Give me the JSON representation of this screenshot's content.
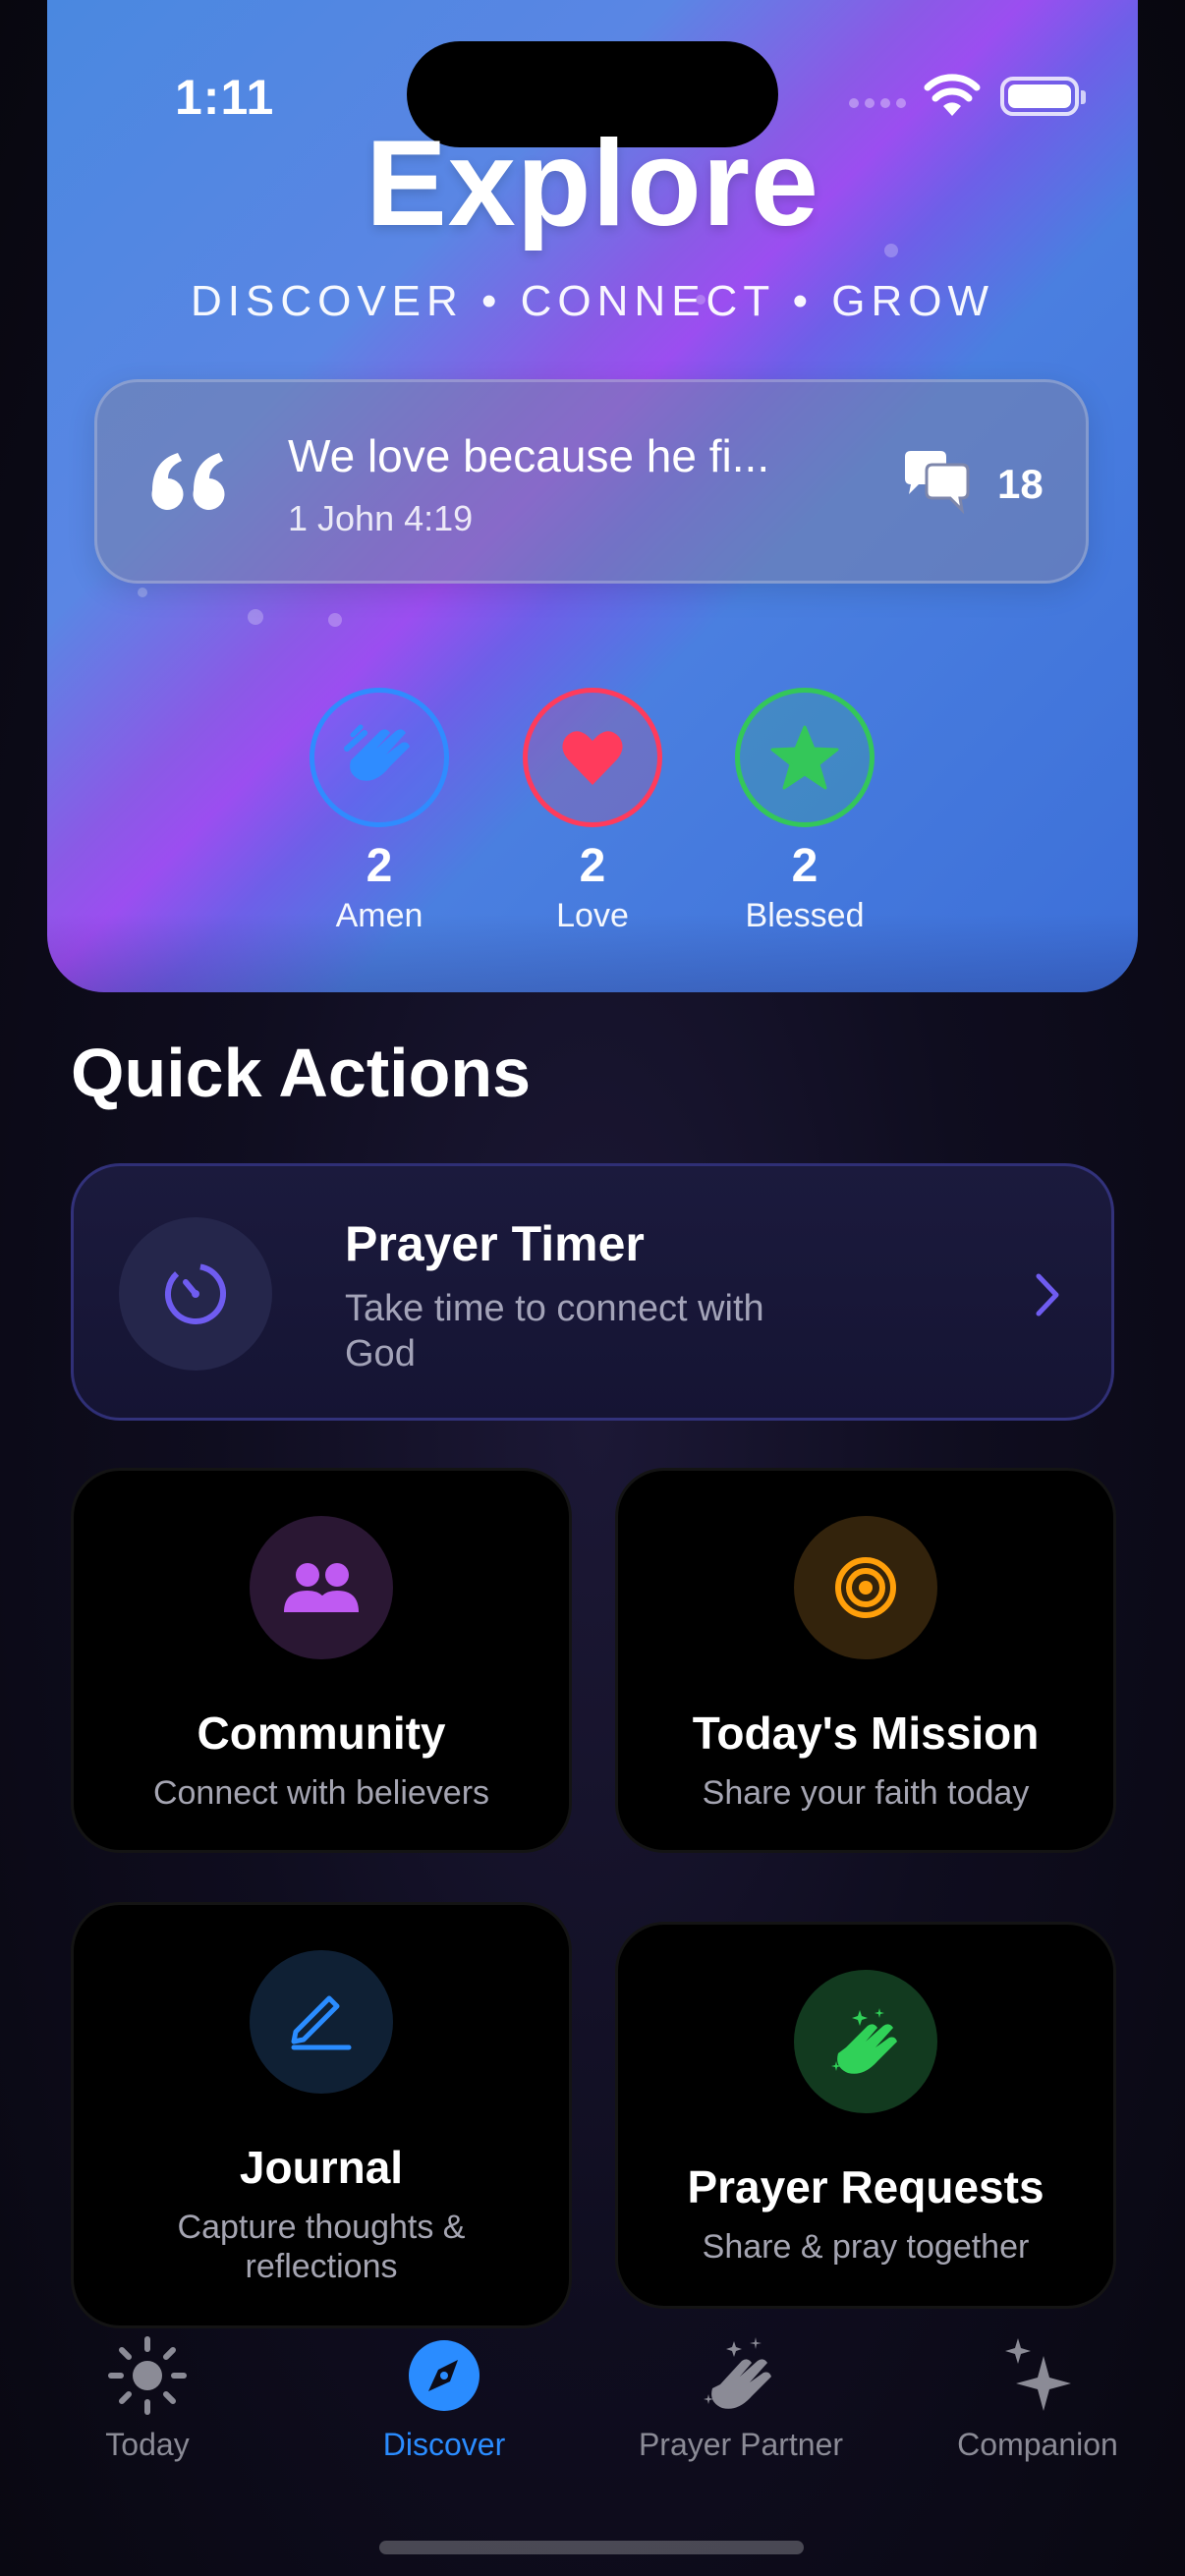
{
  "status_bar": {
    "time": "1:11"
  },
  "hero": {
    "title": "Explore",
    "subtitle": "DISCOVER • CONNECT • GROW",
    "verse": {
      "text": "We love because he fi...",
      "reference": "1 John 4:19",
      "comment_count": "18"
    },
    "reactions": [
      {
        "name": "amen",
        "count": "2",
        "label": "Amen",
        "color": "#2f8cff"
      },
      {
        "name": "love",
        "count": "2",
        "label": "Love",
        "color": "#ff3b5c"
      },
      {
        "name": "blessed",
        "count": "2",
        "label": "Blessed",
        "color": "#34c759"
      }
    ]
  },
  "quick_actions": {
    "title": "Quick Actions",
    "prayer_timer": {
      "title": "Prayer Timer",
      "subtitle": "Take time to connect with God",
      "icon": "timer-icon",
      "accent": "#6f5cf0"
    },
    "tiles": [
      {
        "title": "Community",
        "subtitle": "Connect with believers",
        "icon": "people-icon",
        "accent": "#bf5af2"
      },
      {
        "title": "Today's Mission",
        "subtitle": "Share your faith today",
        "icon": "target-icon",
        "accent": "#ff9f0a"
      },
      {
        "title": "Journal",
        "subtitle": "Capture thoughts & reflections",
        "icon": "pencil-icon",
        "accent": "#2a8cff"
      },
      {
        "title": "Prayer Requests",
        "subtitle": "Share & pray together",
        "icon": "praying-hands-icon",
        "accent": "#30d158"
      }
    ]
  },
  "tab_bar": {
    "tabs": [
      {
        "label": "Today",
        "icon": "sun-icon",
        "active": false
      },
      {
        "label": "Discover",
        "icon": "compass-icon",
        "active": true
      },
      {
        "label": "Prayer Partner",
        "icon": "praying-hands-icon",
        "active": false
      },
      {
        "label": "Companion",
        "icon": "sparkles-icon",
        "active": false
      }
    ]
  }
}
